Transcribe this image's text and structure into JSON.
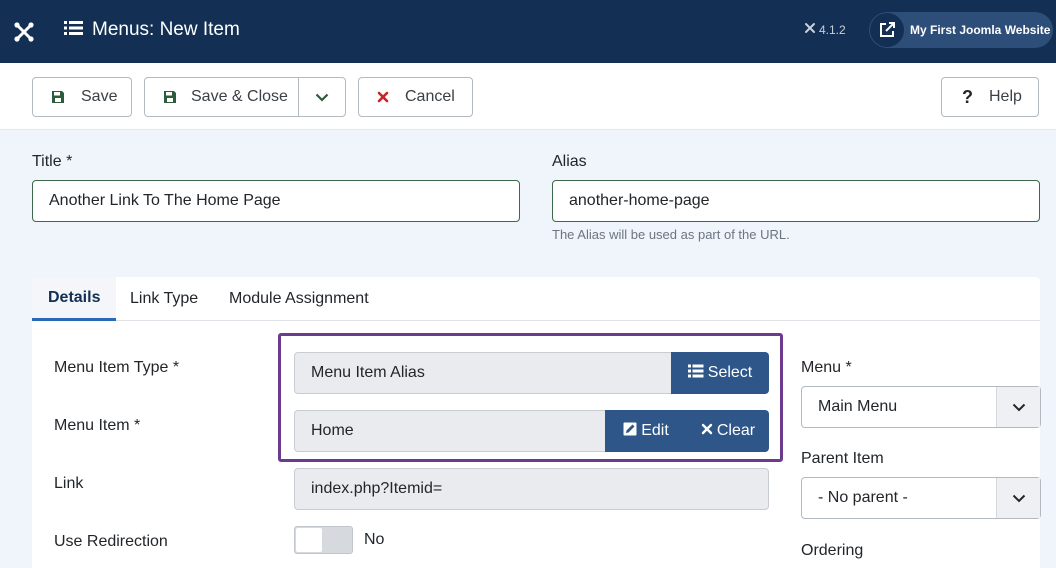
{
  "header": {
    "title": "Menus: New Item",
    "version": "4.1.2",
    "site_link_label": "My First Joomla Website",
    "colors": {
      "background": "#132f53",
      "pill": "#2c4e78"
    }
  },
  "toolbar": {
    "save_label": "Save",
    "save_close_label": "Save & Close",
    "cancel_label": "Cancel",
    "help_label": "Help"
  },
  "form": {
    "title_label": "Title *",
    "title_value": "Another Link To The Home Page",
    "alias_label": "Alias",
    "alias_value": "another-home-page",
    "alias_hint": "The Alias will be used as part of the URL."
  },
  "tabs": [
    {
      "label": "Details",
      "active": true
    },
    {
      "label": "Link Type",
      "active": false
    },
    {
      "label": "Module Assignment",
      "active": false
    }
  ],
  "details": {
    "menu_item_type_label": "Menu Item Type *",
    "menu_item_type_value": "Menu Item Alias",
    "select_label": "Select",
    "menu_item_label": "Menu Item *",
    "menu_item_value": "Home",
    "edit_label": "Edit",
    "clear_label": "Clear",
    "link_label": "Link",
    "link_value": "index.php?Itemid=",
    "redirect_label": "Use Redirection",
    "redirect_value": "No"
  },
  "sidebar": {
    "menu_label": "Menu *",
    "menu_value": "Main Menu",
    "parent_label": "Parent Item",
    "parent_value": "- No parent -",
    "ordering_label": "Ordering"
  },
  "colors": {
    "accent_blue": "#2e5689",
    "highlight": "#6d3b8e",
    "cancel_red": "#c52827",
    "save_green": "#2f5b3d"
  }
}
